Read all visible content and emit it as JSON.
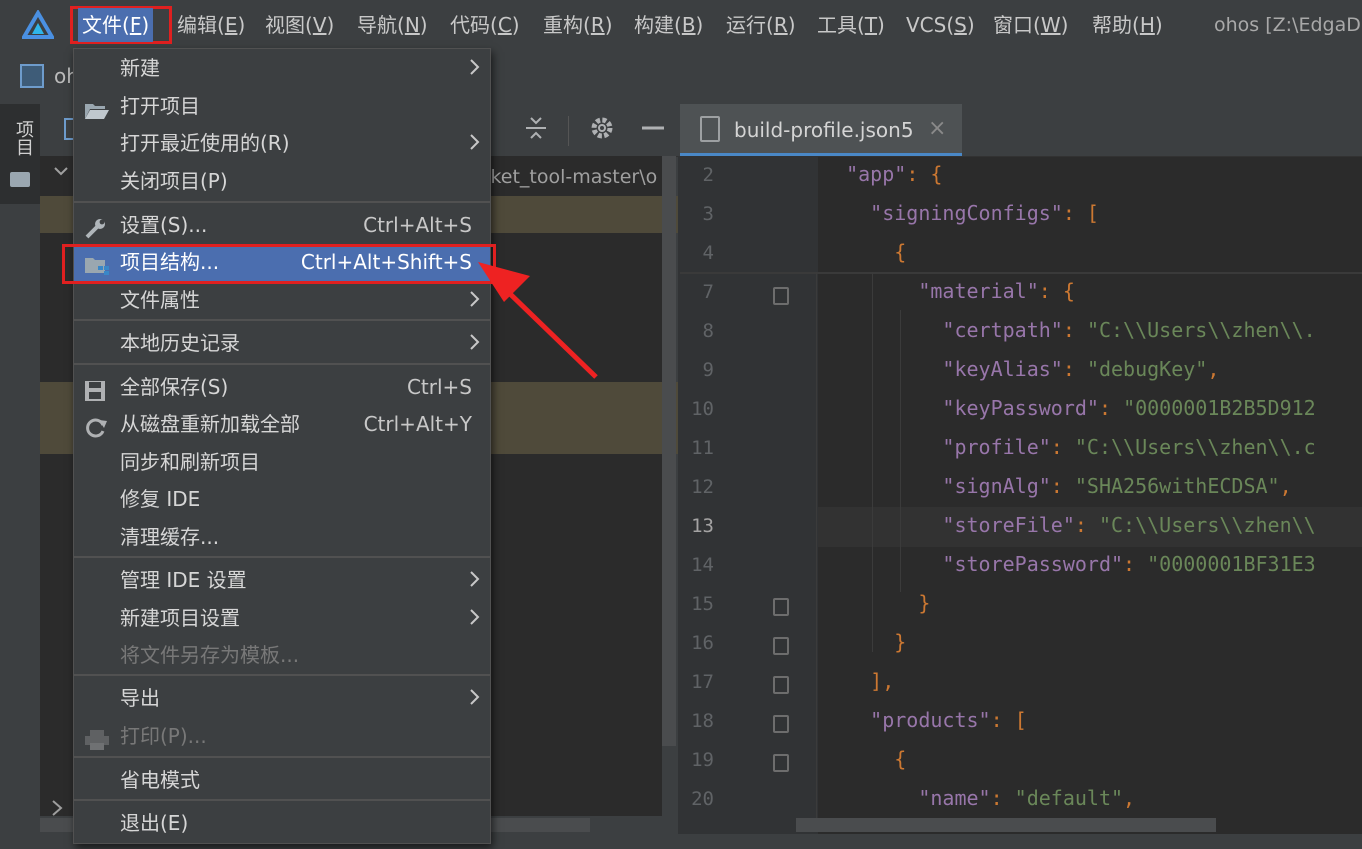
{
  "menubar": {
    "items": [
      {
        "label": "文件",
        "mnemonic": "F"
      },
      {
        "label": "编辑",
        "mnemonic": "E"
      },
      {
        "label": "视图",
        "mnemonic": "V"
      },
      {
        "label": "导航",
        "mnemonic": "N"
      },
      {
        "label": "代码",
        "mnemonic": "C"
      },
      {
        "label": "重构",
        "mnemonic": "R"
      },
      {
        "label": "构建",
        "mnemonic": "B"
      },
      {
        "label": "运行",
        "mnemonic": "R"
      },
      {
        "label": "工具",
        "mnemonic": "T"
      },
      {
        "label": "VCS",
        "mnemonic": "S"
      },
      {
        "label": "窗口",
        "mnemonic": "W"
      },
      {
        "label": "帮助",
        "mnemonic": "H"
      }
    ],
    "project_path": "ohos [Z:\\EdgaD"
  },
  "navbar": {
    "module_label": "oh"
  },
  "tool_strip": {
    "project_label": "项目"
  },
  "project_pane": {
    "path_fragment": "cket_tool-master\\o"
  },
  "editor": {
    "tab_title": "build-profile.json5",
    "close_glyph": "×"
  },
  "file_menu": {
    "items": [
      {
        "label": "新建",
        "shortcut": "",
        "submenu": true
      },
      {
        "label": "打开项目",
        "shortcut": "",
        "submenu": false,
        "icon": "folder-open-icon"
      },
      {
        "label": "打开最近使用的(R)",
        "shortcut": "",
        "submenu": true
      },
      {
        "label": "关闭项目(P)",
        "shortcut": "",
        "submenu": false
      },
      {
        "label": "设置(S)...",
        "shortcut": "Ctrl+Alt+S",
        "submenu": false,
        "icon": "wrench-icon"
      },
      {
        "label": "项目结构...",
        "shortcut": "Ctrl+Alt+Shift+S",
        "submenu": false,
        "icon": "project-structure-icon",
        "selected": true
      },
      {
        "label": "文件属性",
        "shortcut": "",
        "submenu": true
      },
      {
        "label": "本地历史记录",
        "shortcut": "",
        "submenu": true
      },
      {
        "label": "全部保存(S)",
        "shortcut": "Ctrl+S",
        "submenu": false,
        "icon": "save-icon"
      },
      {
        "label": "从磁盘重新加载全部",
        "shortcut": "Ctrl+Alt+Y",
        "submenu": false,
        "icon": "reload-icon"
      },
      {
        "label": "同步和刷新项目",
        "shortcut": "",
        "submenu": false
      },
      {
        "label": "修复 IDE",
        "shortcut": "",
        "submenu": false
      },
      {
        "label": "清理缓存...",
        "shortcut": "",
        "submenu": false
      },
      {
        "label": "管理 IDE 设置",
        "shortcut": "",
        "submenu": true
      },
      {
        "label": "新建项目设置",
        "shortcut": "",
        "submenu": true
      },
      {
        "label": "将文件另存为模板...",
        "shortcut": "",
        "submenu": false,
        "disabled": true
      },
      {
        "label": "导出",
        "shortcut": "",
        "submenu": true
      },
      {
        "label": "打印(P)...",
        "shortcut": "",
        "submenu": false,
        "disabled": true,
        "icon": "printer-icon"
      },
      {
        "label": "省电模式",
        "shortcut": "",
        "submenu": false
      },
      {
        "label": "退出(E)",
        "shortcut": "",
        "submenu": false
      }
    ]
  },
  "code_lines": [
    {
      "n": "2",
      "text": "  \"app\": {"
    },
    {
      "n": "3",
      "text": "    \"signingConfigs\": ["
    },
    {
      "n": "4",
      "text": "      {"
    },
    {
      "n": "7",
      "text": "        \"material\": {"
    },
    {
      "n": "8",
      "text": "          \"certpath\": \"C:\\\\Users\\\\zhen\\\\."
    },
    {
      "n": "9",
      "text": "          \"keyAlias\": \"debugKey\","
    },
    {
      "n": "10",
      "text": "          \"keyPassword\": \"0000001B2B5D912"
    },
    {
      "n": "11",
      "text": "          \"profile\": \"C:\\\\Users\\\\zhen\\\\.c"
    },
    {
      "n": "12",
      "text": "          \"signAlg\": \"SHA256withECDSA\","
    },
    {
      "n": "13",
      "text": "          \"storeFile\": \"C:\\\\Users\\\\zhen\\\\"
    },
    {
      "n": "14",
      "text": "          \"storePassword\": \"0000001BF31E3"
    },
    {
      "n": "15",
      "text": "        }"
    },
    {
      "n": "16",
      "text": "      }"
    },
    {
      "n": "17",
      "text": "    ],"
    },
    {
      "n": "18",
      "text": "    \"products\": ["
    },
    {
      "n": "19",
      "text": "      {"
    },
    {
      "n": "20",
      "text": "        \"name\": \"default\","
    }
  ],
  "colors": {
    "accent": "#4b6eaf",
    "highlight_box": "#e02020",
    "json_key": "#9876aa",
    "json_string": "#6a8759"
  }
}
